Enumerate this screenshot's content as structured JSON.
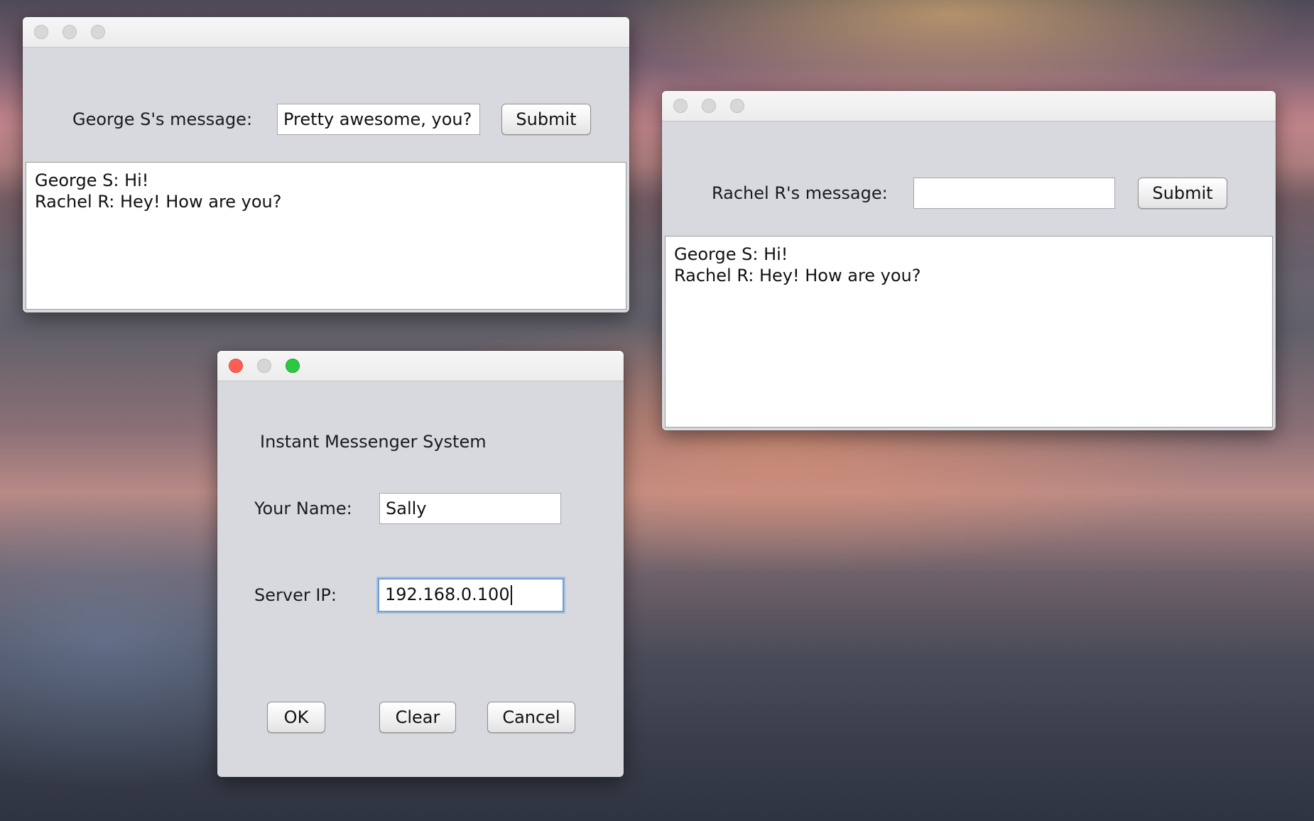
{
  "george_window": {
    "message_label": "George S's message:",
    "message_value": "Pretty awesome, you?",
    "submit_label": "Submit",
    "chat_lines": [
      "George S: Hi!",
      "Rachel R: Hey! How are you?"
    ]
  },
  "rachel_window": {
    "message_label": "Rachel R's message:",
    "message_value": "",
    "submit_label": "Submit",
    "chat_lines": [
      "George S: Hi!",
      "Rachel R: Hey! How are you?"
    ]
  },
  "login_dialog": {
    "title": "Instant Messenger System",
    "name_label": "Your Name:",
    "name_value": "Sally",
    "server_label": "Server IP:",
    "server_value": "192.168.0.100",
    "ok_label": "OK",
    "clear_label": "Clear",
    "cancel_label": "Cancel"
  }
}
